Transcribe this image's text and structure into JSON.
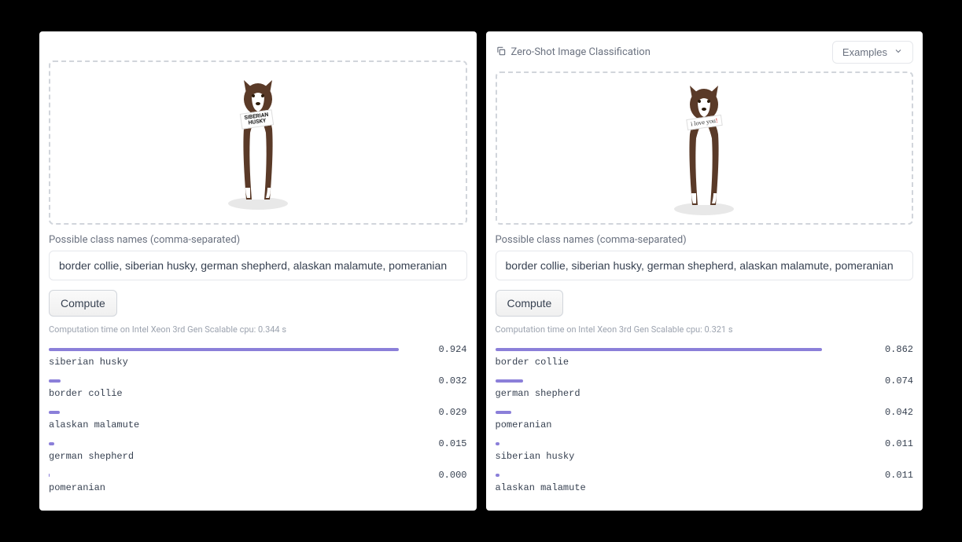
{
  "header": {
    "title": "Zero-Shot Image Classification",
    "examples_label": "Examples"
  },
  "left": {
    "image_sign": "SIBERIAN\nHUSKY",
    "classes_label": "Possible class names (comma-separated)",
    "classes_value": "border collie, siberian husky, german shepherd, alaskan malamute, pomeranian",
    "compute_label": "Compute",
    "compute_time": "Computation time on Intel Xeon 3rd Gen Scalable cpu: 0.344 s",
    "results": [
      {
        "label": "siberian husky",
        "score": "0.924",
        "pct": 92.4
      },
      {
        "label": "border collie",
        "score": "0.032",
        "pct": 3.2
      },
      {
        "label": "alaskan malamute",
        "score": "0.029",
        "pct": 2.9
      },
      {
        "label": "german shepherd",
        "score": "0.015",
        "pct": 1.5
      },
      {
        "label": "pomeranian",
        "score": "0.000",
        "pct": 0.3
      }
    ]
  },
  "right": {
    "image_sign": "i love you",
    "image_sign_excl": "!",
    "classes_label": "Possible class names (comma-separated)",
    "classes_value": "border collie, siberian husky, german shepherd, alaskan malamute, pomeranian",
    "compute_label": "Compute",
    "compute_time": "Computation time on Intel Xeon 3rd Gen Scalable cpu: 0.321 s",
    "results": [
      {
        "label": "border collie",
        "score": "0.862",
        "pct": 86.2
      },
      {
        "label": "german shepherd",
        "score": "0.074",
        "pct": 7.4
      },
      {
        "label": "pomeranian",
        "score": "0.042",
        "pct": 4.2
      },
      {
        "label": "siberian husky",
        "score": "0.011",
        "pct": 1.1
      },
      {
        "label": "alaskan malamute",
        "score": "0.011",
        "pct": 1.1
      }
    ]
  }
}
